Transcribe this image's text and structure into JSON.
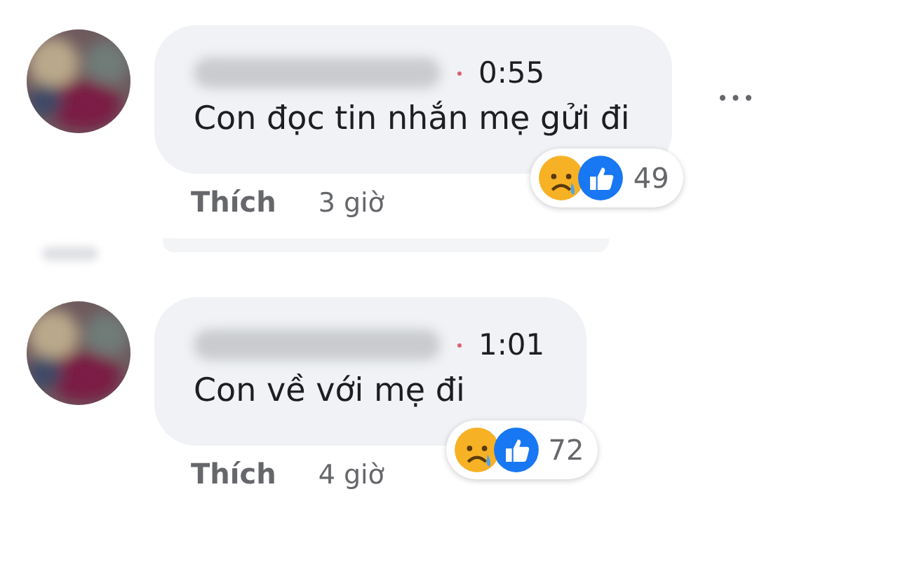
{
  "comments": [
    {
      "time": "0:55",
      "text": "Con đọc tin nhắn mẹ gửi đi",
      "reaction_count": "49",
      "like_label": "Thích",
      "age": "3 giờ",
      "more": "•••"
    },
    {
      "time": "1:01",
      "text": "Con về với mẹ đi",
      "reaction_count": "72",
      "like_label": "Thích",
      "age": "4 giờ"
    }
  ]
}
